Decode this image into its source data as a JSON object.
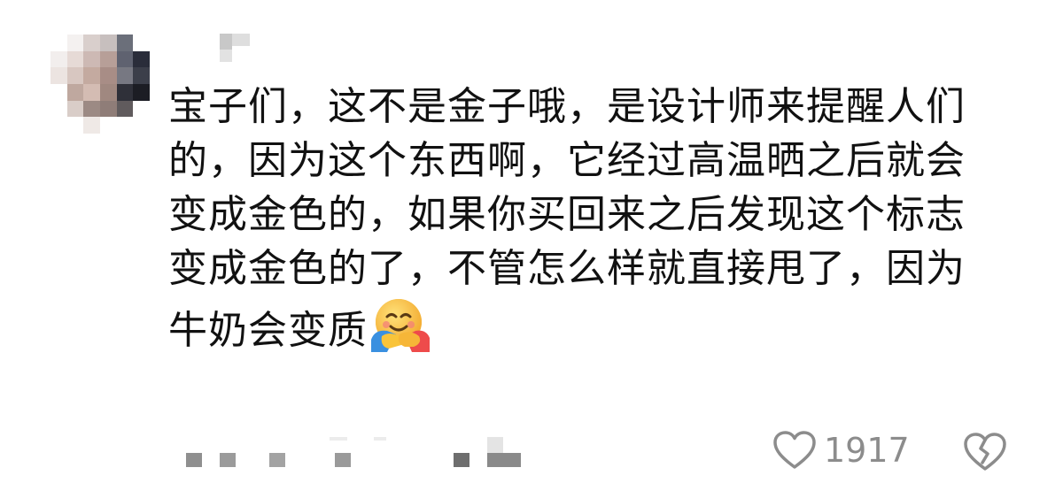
{
  "comment": {
    "lines": [
      "宝子们，这不是金子哦，是设计师来提醒人们",
      "的，因为这个东西啊，它经过高温晒之后就会",
      "变成金色的，如果你买回来之后发现这个标志",
      "变成金色的了，不管怎么样就直接甩了，因为",
      "牛奶会变质"
    ],
    "emoji": "hugging-face-emoji",
    "like_count": "1917"
  },
  "icons": {
    "like": "heart-outline-icon",
    "dislike": "broken-heart-icon"
  },
  "colors": {
    "text": "#111111",
    "meta_text": "#8c8c8c",
    "icon": "#8c8c8c",
    "background": "#ffffff"
  }
}
